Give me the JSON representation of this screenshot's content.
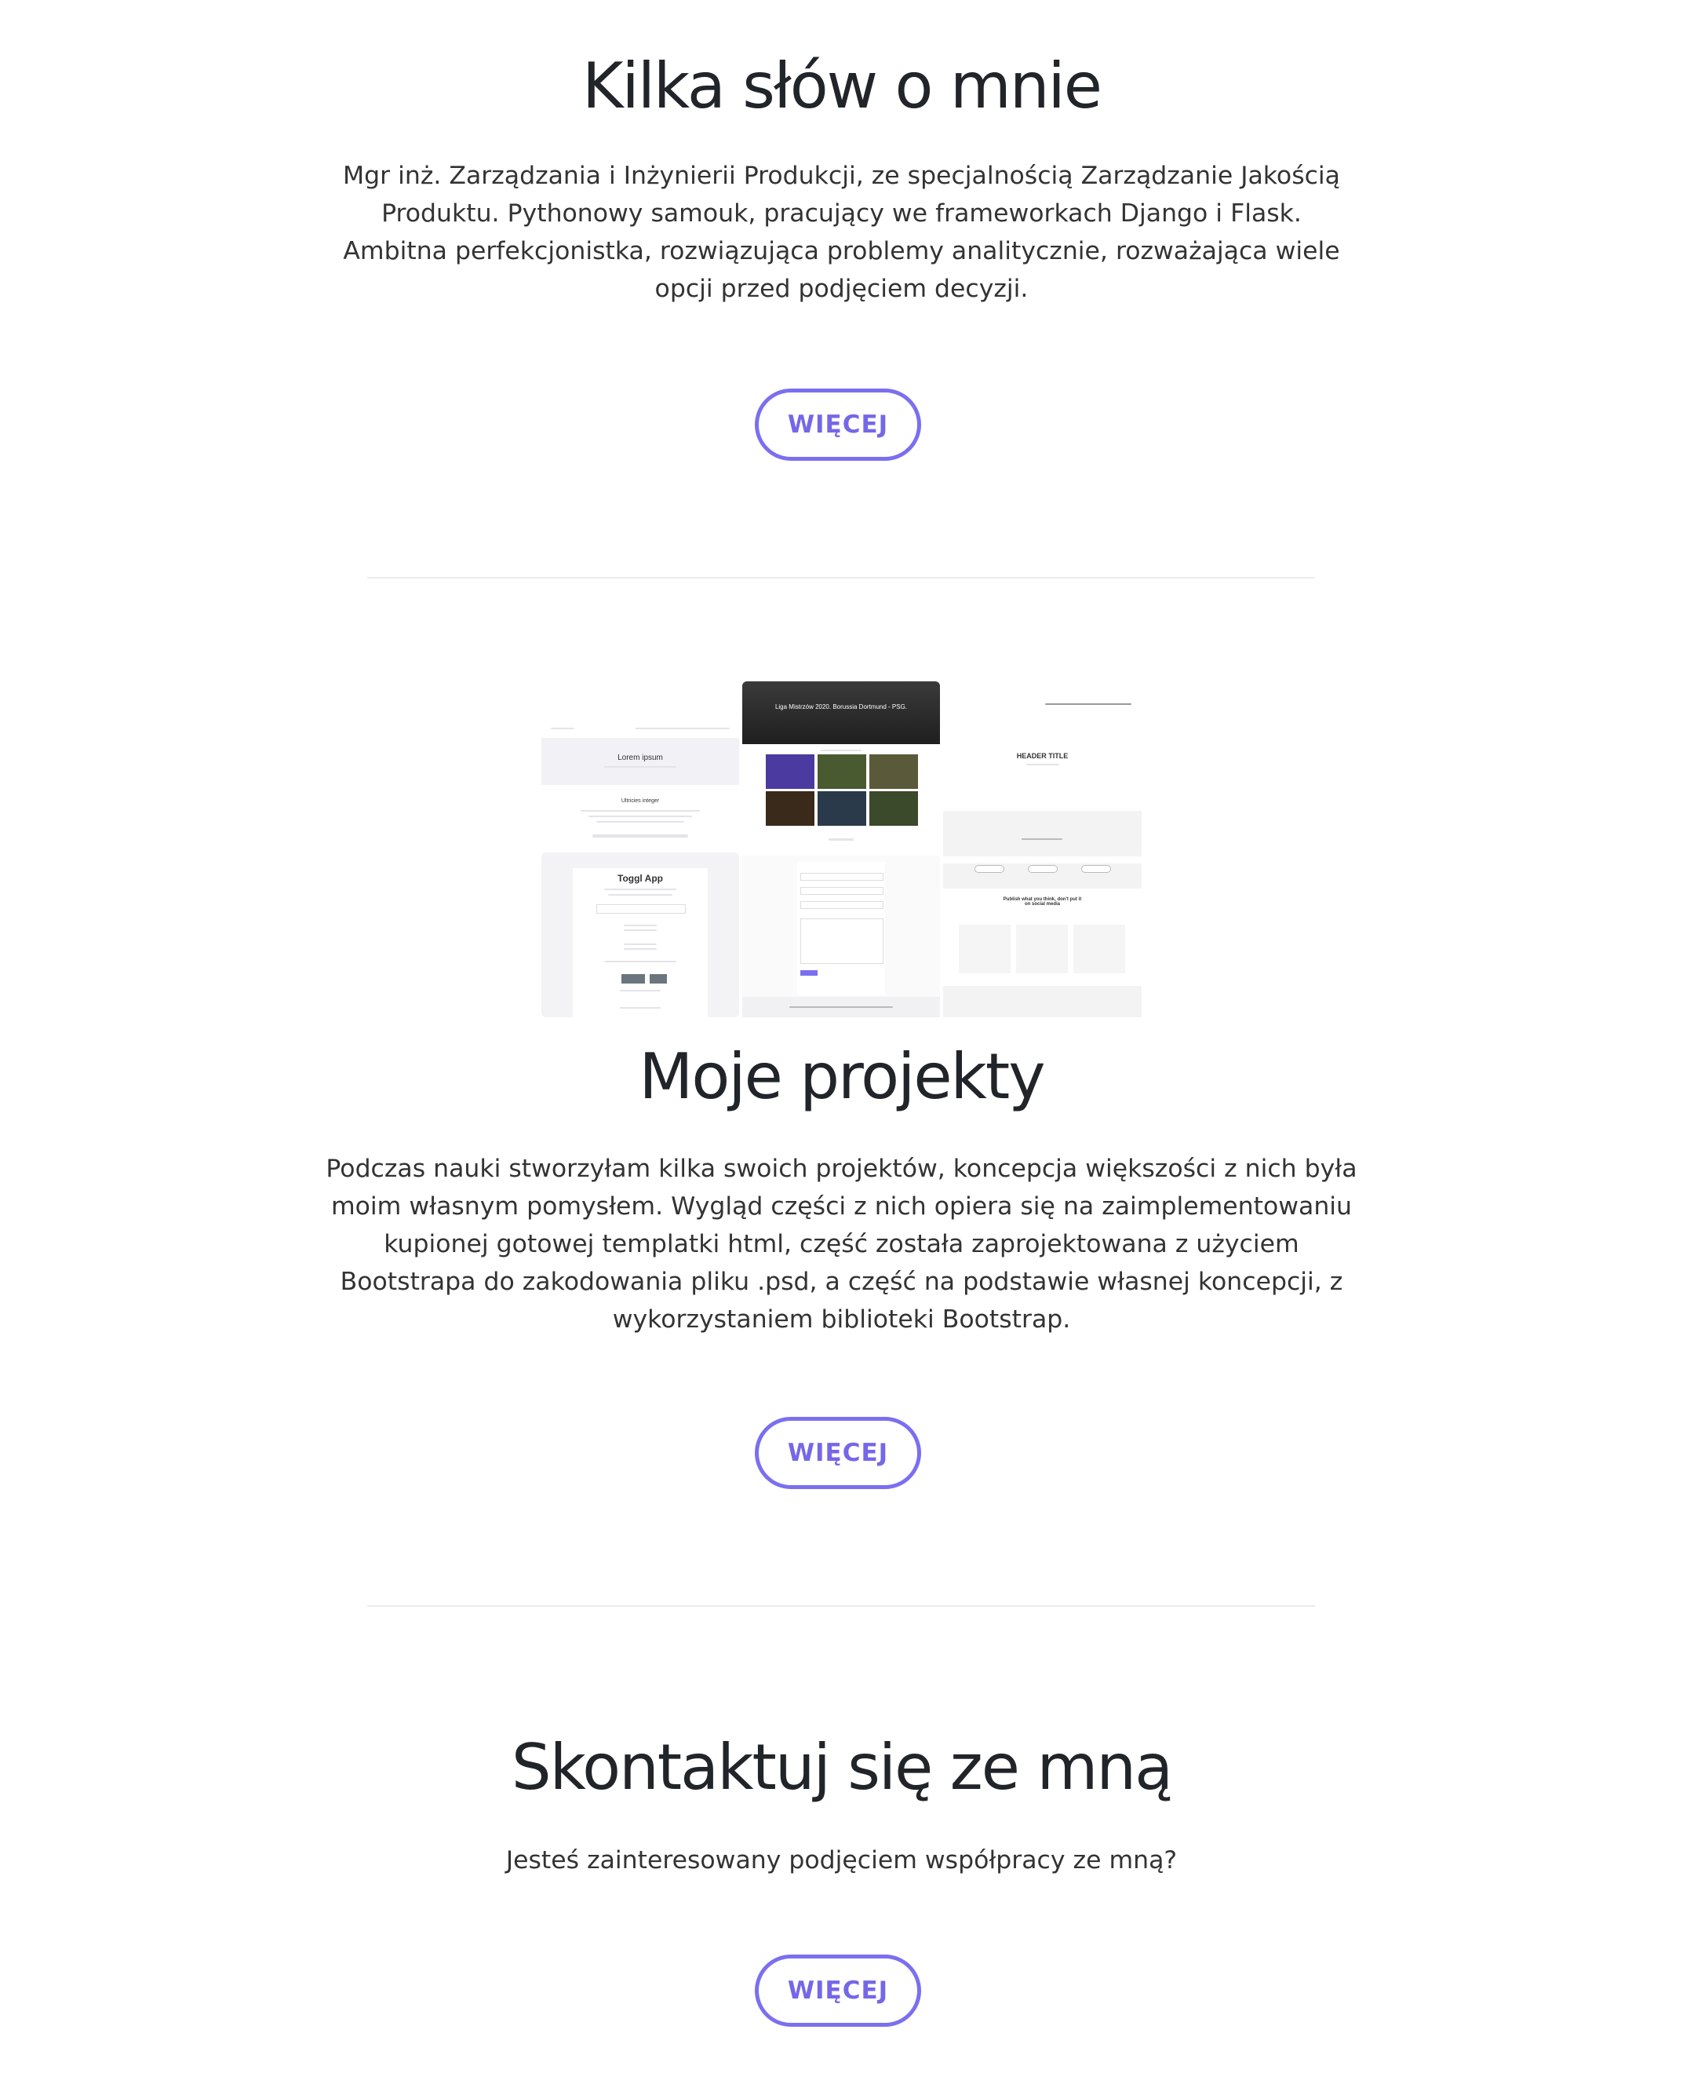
{
  "about": {
    "title": "Kilka słów o mnie",
    "lines": [
      "Mgr inż. Zarządzania i Inżynierii Produkcji, ze specjalnością Zarządzanie Jakością",
      "Produktu. Pythonowy samouk, pracujący we frameworkach Django i Flask.",
      "Ambitna perfekcjonistka, rozwiązująca problemy analitycznie, rozważająca wiele",
      "opcji przed podjęciem decyzji."
    ],
    "button_label": "WIĘCEJ"
  },
  "projects": {
    "title": "Moje projekty",
    "lines": [
      "Podczas nauki stworzyłam kilka swoich projektów, koncepcja większości z nich była",
      "moim własnym pomysłem. Wygląd części z nich opiera się na zaimplementowaniu",
      "kupionej gotowej templatki html, część została zaprojektowana z użyciem",
      "Bootstrapa do zakodowania pliku .psd, a część na podstawie własnej koncepcji, z",
      "wykorzystaniem biblioteki Bootstrap."
    ],
    "button_label": "WIĘCEJ",
    "collage": {
      "hero_title": "Liga Mistrzów 2020. Borussia Dortmund - PSG.",
      "lorem_title": "Lorem ipsum",
      "lorem_sub": "Ultricies integer",
      "toggl_title": "Toggl App",
      "header_title": "HEADER TITLE",
      "publish_text": "Publish what you think, don't put it on social media"
    }
  },
  "contact": {
    "title": "Skontaktuj się ze mną",
    "text": "Jesteś zainteresowany podjęciem współpracy ze mną?",
    "button_label": "WIĘCEJ"
  },
  "colors": {
    "accent": "#7b6ff0",
    "heading": "#212529",
    "divider": "#ebebeb"
  }
}
